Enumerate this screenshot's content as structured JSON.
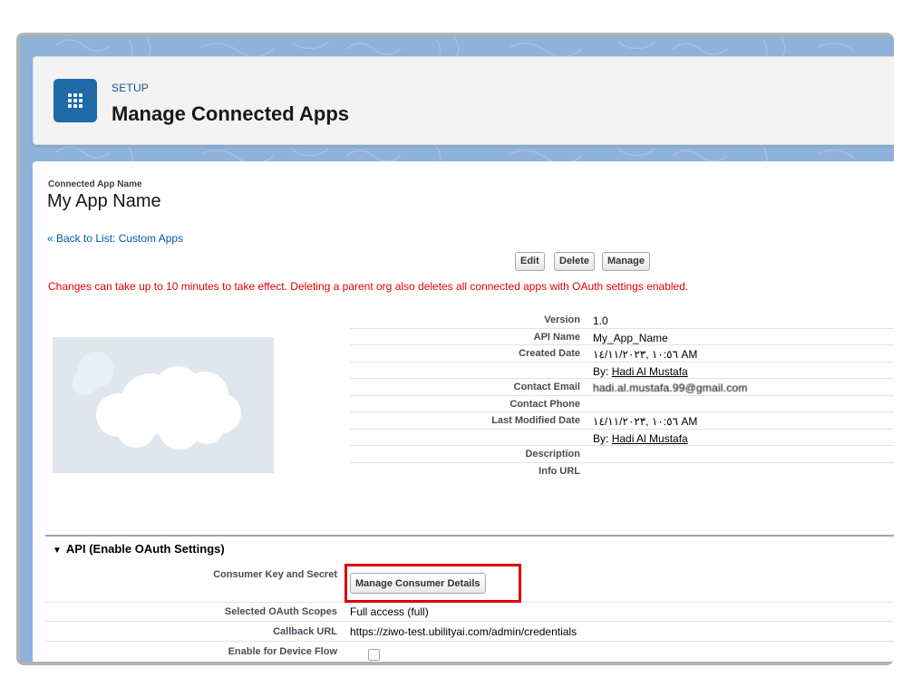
{
  "header": {
    "section_label": "SETUP",
    "title": "Manage Connected Apps",
    "icon": "app-grid-icon"
  },
  "app": {
    "name_label": "Connected App Name",
    "name": "My App Name",
    "back_link": "« Back to List: Custom Apps"
  },
  "actions": {
    "edit": "Edit",
    "delete": "Delete",
    "manage": "Manage"
  },
  "warning": "Changes can take up to 10 minutes to take effect. Deleting a parent org also deletes all connected apps with OAuth settings enabled.",
  "details": {
    "version_label": "Version",
    "version": "1.0",
    "api_name_label": "API Name",
    "api_name": "My_App_Name",
    "created_date_label": "Created Date",
    "created_date": "١٠:٥٦ ,١٤/١١/٢٠٢٣ AM",
    "created_by_prefix": "By:",
    "created_by": "Hadi Al Mustafa",
    "contact_email_label": "Contact Email",
    "contact_email": "hadi.al.mustafa.99@gmail.com",
    "contact_phone_label": "Contact Phone",
    "last_modified_label": "Last Modified Date",
    "last_modified_date": "١٠:٥٦ ,١٤/١١/٢٠٢٣ AM",
    "modified_by_prefix": "By:",
    "modified_by": "Hadi Al Mustafa",
    "description_label": "Description",
    "info_url_label": "Info URL"
  },
  "api_section": {
    "title": "API (Enable OAuth Settings)",
    "consumer_key_label": "Consumer Key and Secret",
    "manage_consumer_button": "Manage Consumer Details",
    "scopes_label": "Selected OAuth Scopes",
    "scopes_value": "Full access (full)",
    "callback_label": "Callback URL",
    "callback_value": "https://ziwo-test.ubilityai.com/admin/credentials",
    "device_flow_label": "Enable for Device Flow"
  },
  "colors": {
    "brand_blue": "#1f6aa8",
    "link_blue": "#015ba7",
    "warning_red": "#e60000",
    "highlight_red": "#e00000"
  }
}
